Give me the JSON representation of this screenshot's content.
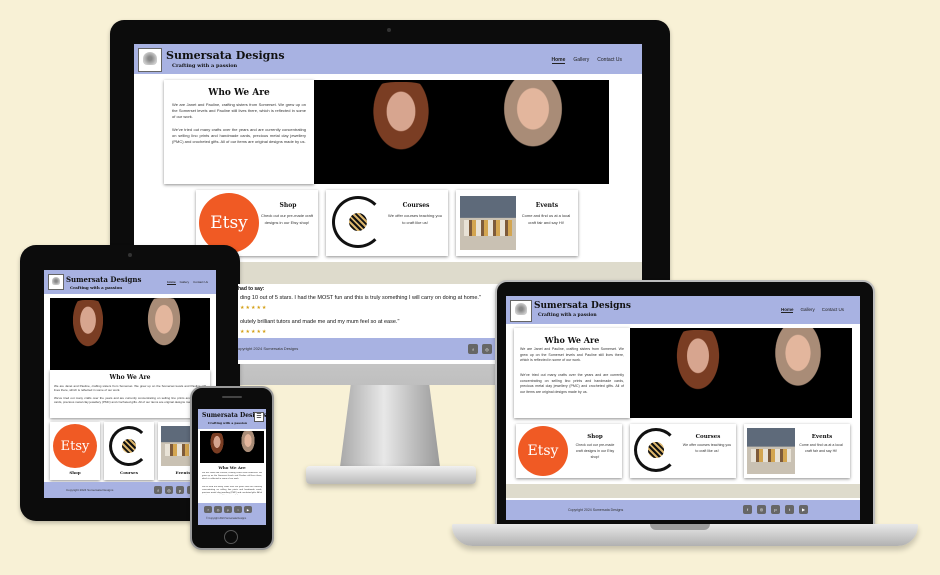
{
  "site": {
    "brand": "Sumersata Designs",
    "tagline": "Crafting with a passion",
    "nav": [
      "Home",
      "Gallery",
      "Contact Us"
    ],
    "who_title": "Who We Are",
    "who_p1": "We are Janet and Pauline, crafting sisters from Somerset. We grew up on the Somerset levels and Pauline still lives there, which is reflected in some of our work.",
    "who_p2": "We've tried out many crafts over the years and are currently concentrating on selling lino prints and handmade cards, precious metal clay jewellery (PMC) and crocheted gifts. All of our items are original designs made by us.",
    "cards": [
      {
        "title": "Shop",
        "text": "Check out our pre-made craft designs in our Etsy shop!",
        "logo": "Etsy"
      },
      {
        "title": "Courses",
        "text": "We offer courses teaching you to craft like us!"
      },
      {
        "title": "Events",
        "text": "Come and find us at a local craft fair and say Hi!"
      }
    ],
    "testimonials_heading": "had to say:",
    "testimonials": [
      {
        "text": "ding 10 out of 5 stars. I had the MOST fun and this is truly something I will carry on doing at home.\"",
        "stars": "★★★★★"
      },
      {
        "text": "olutely brilliant tutors and made me and my mum feel so at ease.\"",
        "stars": "★★★★★"
      }
    ],
    "copyright": "Copyright 2024 Sumersata Designs",
    "copyright_short": "opyright 2024 Sumersata Designs",
    "social_icons": [
      "facebook-icon",
      "instagram-icon",
      "pinterest-icon",
      "twitter-icon",
      "youtube-icon"
    ],
    "social_glyphs": [
      "f",
      "◎",
      "p",
      "t",
      "▶"
    ],
    "mobile_footer": "© Copyright 2024 Sumersata Designs",
    "mobile_menu_icon": "☰"
  },
  "colors": {
    "header": "#a8b2e2",
    "background": "#f8f1d6",
    "etsy": "#f05a24"
  }
}
